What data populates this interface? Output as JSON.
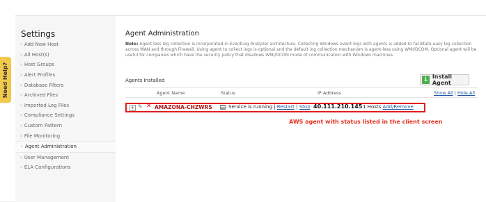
{
  "help_tab": "Need Help?",
  "sidebar": {
    "title": "Settings",
    "items": [
      {
        "label": "Add New Host"
      },
      {
        "label": "All Host(s)"
      },
      {
        "label": "Host Groups"
      },
      {
        "label": "Alert Profiles"
      },
      {
        "label": "Database Filters"
      },
      {
        "label": "Archived Files"
      },
      {
        "label": "Imported Log Files"
      },
      {
        "label": "Compliance Settings"
      },
      {
        "label": "Custom Pattern"
      },
      {
        "label": "File Monitoring"
      },
      {
        "label": "Agent Administration"
      },
      {
        "label": "User Management"
      },
      {
        "label": "ELA Configurations"
      }
    ]
  },
  "main": {
    "title": "Agent Administration",
    "note_label": "Note:",
    "note_text": "Agent less log collection is incorporated in EventLog Analyzer architecture. Collecting Windows event logs with agents is added to facilitate easy log collection across WAN and through Firewall. Using agent to collect logs is optional and the default log collection mechanism is agent-less using WMI/DCOM. Optional agent will be useful for companies which have the security policy that disallows WMI/DCOM mode of communication with Windows machines.",
    "section_label": "Agents Installed",
    "install_button": "Install Agent",
    "table": {
      "headers": {
        "agent_name": "Agent Name",
        "status": "Status",
        "ip_address": "IP Address"
      },
      "show_all": "Show All",
      "separator": "|",
      "hide_all": "Hide All",
      "rows": [
        {
          "agent_name": "AMAZONA-CHZWRS",
          "status": "Service is running",
          "restart": "Restart",
          "stop": "Stop",
          "ip": "40.111.210.145",
          "hosts": "1 Hosts",
          "add_remove": "Add/Remove"
        }
      ]
    },
    "annotation": "AWS agent with status listed in the client screen"
  },
  "colors": {
    "annotation": "#e53020",
    "highlight_border": "#e21b1b",
    "link": "#1f57a5"
  }
}
